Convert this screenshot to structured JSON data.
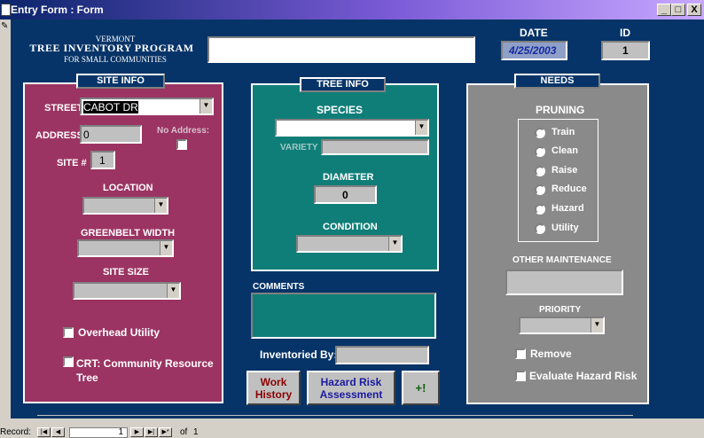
{
  "window": {
    "title": "Entry Form : Form",
    "minimize": "_",
    "maximize": "□",
    "close": "X"
  },
  "header": {
    "line1": "VERMONT",
    "line2": "TREE INVENTORY PROGRAM",
    "line3": "FOR SMALL COMMUNITIES",
    "date_label": "DATE",
    "date_value": "4/25/2003",
    "id_label": "ID",
    "id_value": "1"
  },
  "site": {
    "title": "SITE INFO",
    "street_label": "STREET",
    "street_value": "CABOT DR",
    "address_label": "ADDRESS",
    "address_value": "0",
    "no_address_label": "No Address:",
    "site_no_label": "SITE #",
    "site_no_value": "1",
    "location_label": "LOCATION",
    "greenbelt_label": "GREENBELT WIDTH",
    "site_size_label": "SITE SIZE",
    "overhead_label": "Overhead Utility",
    "crt_label_1": "CRT: Community Resource",
    "crt_label_2": "Tree"
  },
  "tree": {
    "title": "TREE INFO",
    "species_label": "SPECIES",
    "variety_label": "VARIETY",
    "diameter_label": "DIAMETER",
    "diameter_value": "0",
    "condition_label": "CONDITION"
  },
  "comments": {
    "label": "COMMENTS",
    "inventoried_label": "Inventoried By:"
  },
  "buttons": {
    "work1": "Work",
    "work2": "History",
    "hazard1": "Hazard Risk",
    "hazard2": "Assessment",
    "add": "+!"
  },
  "needs": {
    "title": "NEEDS",
    "pruning_label": "PRUNING",
    "options": [
      "Train",
      "Clean",
      "Raise",
      "Reduce",
      "Hazard",
      "Utility"
    ],
    "other_label": "OTHER MAINTENANCE",
    "priority_label": "PRIORITY",
    "remove_label": "Remove",
    "evaluate_label": "Evaluate Hazard Risk"
  },
  "record": {
    "label": "Record:",
    "current": "1",
    "of_label": "of",
    "total": "1"
  },
  "colors": {
    "form_bg": "#073468",
    "site_panel": "#9b3462",
    "tree_panel": "#107e78",
    "needs_panel": "#8a8a8a",
    "date_text": "#1a2aa0",
    "work_text": "#8b0000",
    "hazard_text": "#1a1aa0"
  }
}
